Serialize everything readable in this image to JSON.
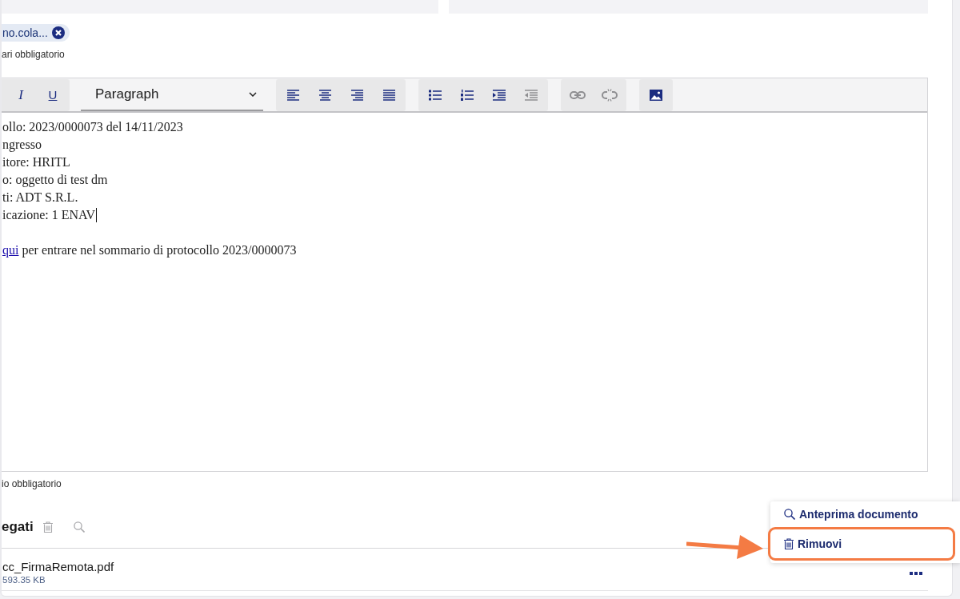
{
  "recipients": {
    "chips": [
      {
        "label": "no.cola..."
      }
    ],
    "hint": "ari obbligatorio"
  },
  "editor": {
    "toolbar": [
      {
        "kind": "group",
        "buttons": [
          {
            "kind": "italic",
            "label": "I",
            "disabled": false
          },
          {
            "kind": "underline",
            "label": "U",
            "disabled": false
          }
        ]
      },
      {
        "kind": "select",
        "value": "Paragraph"
      },
      {
        "kind": "group",
        "buttons": [
          {
            "kind": "alignleft",
            "disabled": false
          },
          {
            "kind": "aligncenter",
            "disabled": false
          },
          {
            "kind": "alignright",
            "disabled": false
          },
          {
            "kind": "justify",
            "disabled": false
          }
        ]
      },
      {
        "kind": "group",
        "buttons": [
          {
            "kind": "bullets",
            "disabled": false
          },
          {
            "kind": "numbers",
            "disabled": false
          },
          {
            "kind": "indent",
            "disabled": false
          },
          {
            "kind": "outdent",
            "disabled": true
          }
        ]
      },
      {
        "kind": "group",
        "buttons": [
          {
            "kind": "link",
            "disabled": true
          },
          {
            "kind": "unlink",
            "disabled": true
          }
        ]
      },
      {
        "kind": "group",
        "buttons": [
          {
            "kind": "image",
            "disabled": false
          }
        ]
      }
    ],
    "lines": [
      {
        "text": "ollo: 2023/0000073 del 14/11/2023",
        "cursor": false
      },
      {
        "text": "ngresso",
        "cursor": false
      },
      {
        "text": "itore: HRITL",
        "cursor": false
      },
      {
        "text": "o: oggetto di test dm",
        "cursor": false
      },
      {
        "text": "ti: ADT S.R.L.",
        "cursor": false
      },
      {
        "text": "icazione: 1 ENAV",
        "cursor": true
      }
    ],
    "link_line": {
      "link": "qui",
      "text": "per entrare nel sommario di protocollo 2023/0000073"
    },
    "hint": "io obbligatorio"
  },
  "attachments": {
    "title": "egati",
    "actions": [
      {
        "kind": "delete",
        "disabled": true
      },
      {
        "kind": "search",
        "disabled": true
      }
    ],
    "files": [
      {
        "name": "cc_FirmaRemota.pdf",
        "size": "593.35 KB"
      }
    ],
    "menu": [
      {
        "kind": "preview",
        "label": "Anteprima documento",
        "highlighted": false
      },
      {
        "kind": "remove",
        "label": "Rimuovi",
        "highlighted": true
      }
    ]
  }
}
